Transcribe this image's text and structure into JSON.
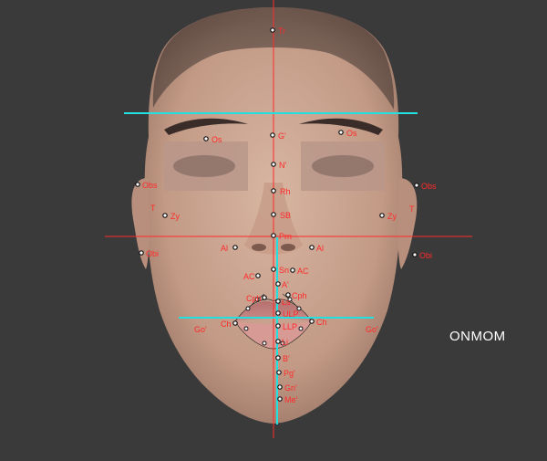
{
  "watermark": "ONMOM",
  "colors": {
    "background": "#3a3a3a",
    "landmark_label": "#ff2a2a",
    "midline": "#ff2a2a",
    "guide_line": "#22e0e0",
    "point": "#111111",
    "skin": "#c9a592"
  },
  "landmarks": {
    "Tr": "Tr",
    "G": "G'",
    "Os_left": "Os",
    "Os_right": "Os",
    "N": "N'",
    "Rh": "Rh",
    "Obs_left": "Obs",
    "Obs_right": "Obs",
    "T_left": "T",
    "T_right": "T",
    "Zy_left": "Zy",
    "Zy_right": "Zy",
    "SB": "SB",
    "Prn": "Prn",
    "Al_left": "Al",
    "Al_right": "Al",
    "Obi_left": "Obi",
    "Obi_right": "Obi",
    "Sn": "Sn",
    "AC_left": "AC",
    "AC_right": "AC",
    "A": "A'",
    "Cph_left": "Cph",
    "Cph_right": "Cph",
    "Ls": "Ls",
    "ULP": "ULP",
    "LLP": "LLP",
    "Ch_left": "Ch",
    "Ch_right": "Ch",
    "Go_left": "Go'",
    "Go_right": "Go'",
    "Li": "Li",
    "B": "B'",
    "Pg": "Pg'",
    "Gn": "Gn'",
    "Me": "Me'"
  }
}
